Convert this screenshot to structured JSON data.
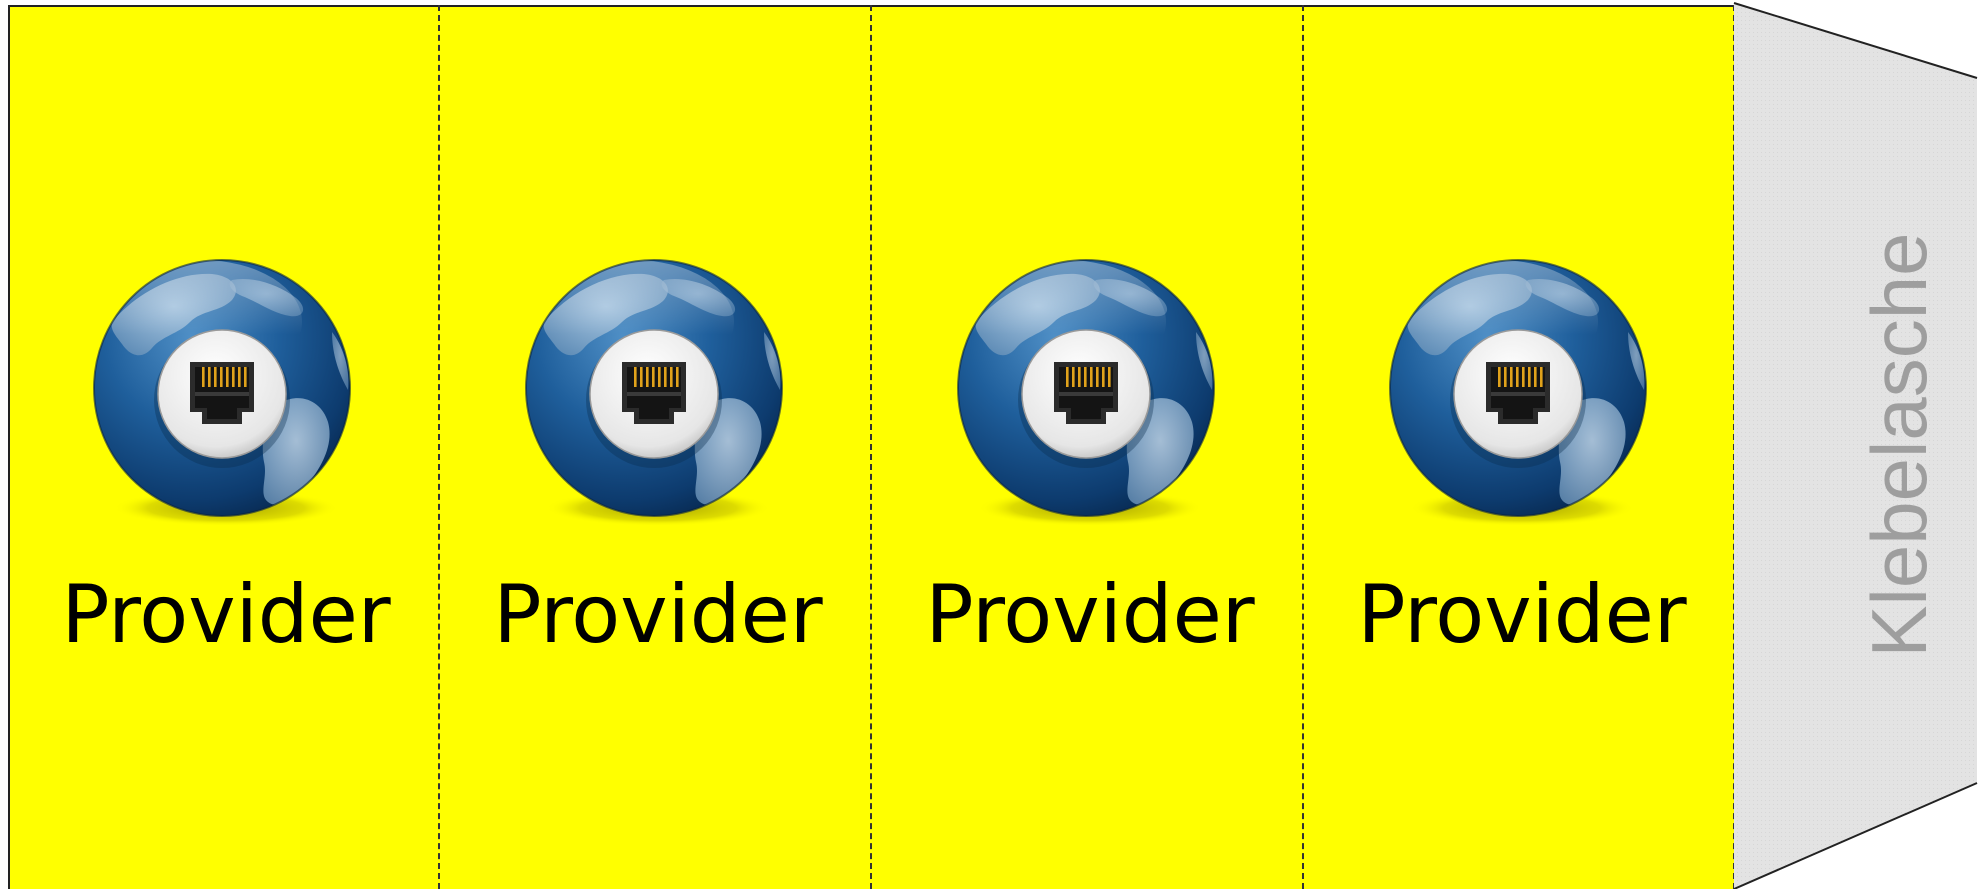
{
  "panels": [
    {
      "label": "Provider",
      "icon": "globe-ethernet-icon"
    },
    {
      "label": "Provider",
      "icon": "globe-ethernet-icon"
    },
    {
      "label": "Provider",
      "icon": "globe-ethernet-icon"
    },
    {
      "label": "Provider",
      "icon": "globe-ethernet-icon"
    }
  ],
  "flap": {
    "label": "Klebelasche"
  },
  "colors": {
    "panel_background": "#ffff00",
    "label_text": "#000000",
    "flap_background": "#e3e3e3",
    "flap_text": "#9e9e9e",
    "fold_line": "#333333"
  }
}
